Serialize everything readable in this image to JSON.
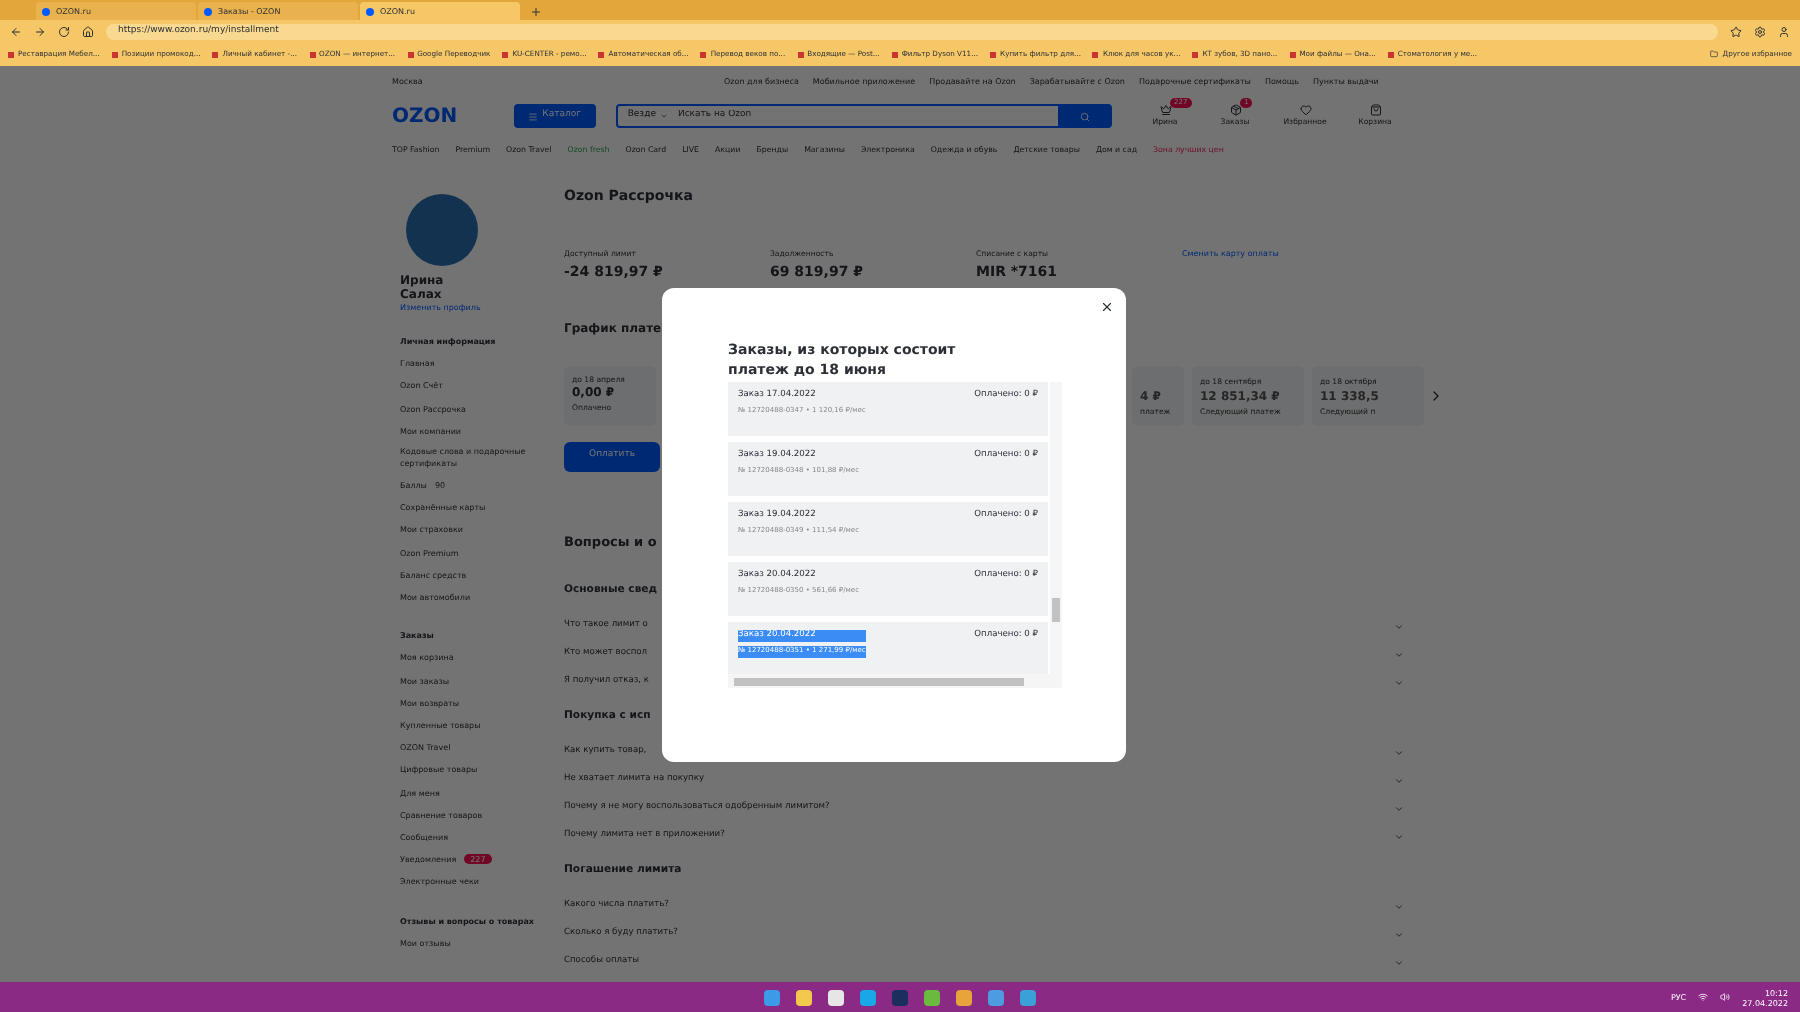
{
  "browser": {
    "tabs": [
      {
        "title": "OZON.ru",
        "selected": false
      },
      {
        "title": "Заказы - OZON",
        "selected": false
      },
      {
        "title": "OZON.ru",
        "selected": true
      }
    ],
    "address": "https://www.ozon.ru/my/installment",
    "bookmarks": [
      "Реставрация Мебел...",
      "Позиции промокод...",
      "Личный кабинет -...",
      "OZON — интернет...",
      "Google Переводчик",
      "KU-CENTER - ремо...",
      "Автоматическая об...",
      "Перевод веков по...",
      "Входящие — Post...",
      "Фильтр Dyson V11...",
      "Купить фильтр для...",
      "Клюк для часов ук...",
      "КТ зубов, 3D пано...",
      "Мои файлы — Она...",
      "Стоматология у ме..."
    ],
    "other_bookmarks": "Другое избранное"
  },
  "site": {
    "city": "Москва",
    "top_links": [
      "Ozon для бизнеса",
      "Мобильное приложение",
      "Продавайте на Ozon",
      "Зарабатывайте с Ozon",
      "Подарочные сертификаты",
      "Помощь",
      "Пункты выдачи"
    ],
    "logo": "OZON",
    "catalog": "Каталог",
    "search": {
      "scope": "Везде",
      "placeholder": "Искать на Ozon"
    },
    "header_icons": [
      {
        "label": "Ирина",
        "badge": "227"
      },
      {
        "label": "Заказы",
        "badge": "1"
      },
      {
        "label": "Избранное"
      },
      {
        "label": "Корзина"
      }
    ],
    "nav": [
      {
        "label": "TOP Fashion",
        "kind": "regular"
      },
      {
        "label": "Premium",
        "kind": "regular"
      },
      {
        "label": "Ozon Travel",
        "kind": "regular"
      },
      {
        "label": "Ozon fresh",
        "kind": "fresh"
      },
      {
        "label": "Ozon Card",
        "kind": "regular"
      },
      {
        "label": "LIVE",
        "kind": "regular"
      },
      {
        "label": "Акции",
        "kind": "regular"
      },
      {
        "label": "Бренды",
        "kind": "regular"
      },
      {
        "label": "Магазины",
        "kind": "regular"
      },
      {
        "label": "Электроника",
        "kind": "regular"
      },
      {
        "label": "Одежда и обувь",
        "kind": "regular"
      },
      {
        "label": "Детские товары",
        "kind": "regular"
      },
      {
        "label": "Дом и сад",
        "kind": "regular"
      },
      {
        "label": "Зона лучших цен",
        "kind": "promo"
      }
    ]
  },
  "sidebar": {
    "name": "Ирина Салах",
    "edit": "Изменить профиль",
    "sections": [
      {
        "title": "Личная информация",
        "items": [
          {
            "label": "Главная"
          },
          {
            "label": "Ozon Счёт"
          },
          {
            "label": "Ozon Рассрочка"
          },
          {
            "label": "Мои компании"
          },
          {
            "label": "Кодовые слова и подарочные сертификаты"
          },
          {
            "label": "Баллы",
            "count": "90"
          },
          {
            "label": "Сохранённые карты"
          },
          {
            "label": "Мои страховки"
          },
          {
            "label": "Ozon Premium"
          },
          {
            "label": "Баланс средств"
          },
          {
            "label": "Мои автомобили"
          }
        ]
      },
      {
        "title": "Заказы",
        "items": [
          {
            "label": "Моя корзина"
          },
          {
            "label": "Мои заказы"
          },
          {
            "label": "Мои возвраты"
          },
          {
            "label": "Купленные товары"
          },
          {
            "label": "OZON Travel"
          },
          {
            "label": "Цифровые товары"
          },
          {
            "label": "Для меня"
          },
          {
            "label": "Сравнение товаров"
          },
          {
            "label": "Сообщения"
          },
          {
            "label": "Уведомления",
            "badge": "227"
          },
          {
            "label": "Электронные чеки"
          }
        ]
      },
      {
        "title": "Отзывы и вопросы о товарах",
        "items": [
          {
            "label": "Мои отзывы"
          }
        ]
      }
    ]
  },
  "main": {
    "title": "Ozon Рассрочка",
    "stats": [
      {
        "label": "Доступный лимит",
        "value": "-24 819,97 ₽"
      },
      {
        "label": "Задолженность",
        "value": "69 819,97 ₽"
      },
      {
        "label": "Списание с карты",
        "value": "MIR *7161"
      }
    ],
    "change_card": "Сменить карту оплаты",
    "schedule_title": "График плате",
    "payments": [
      {
        "date": "до 18 апреля",
        "amount": "0,00 ₽",
        "status": "Оплачено"
      }
    ],
    "payments_right": [
      {
        "amount": "4 ₽",
        "status": "платеж"
      },
      {
        "date": "до 18 сентября",
        "amount": "12 851,34 ₽",
        "status": "Следующий платеж"
      },
      {
        "date": "до 18 октября",
        "amount": "11 338,5",
        "status": "Следующий п"
      }
    ],
    "pay_button": "Оплатить",
    "faq_title": "Вопросы и о",
    "faq": [
      {
        "title": "Основные свед",
        "questions": [
          "Что такое лимит о",
          "Кто может воспол",
          "Я получил отказ, к"
        ]
      },
      {
        "title": "Покупка с исп",
        "questions": [
          "Как купить товар,",
          "Не хватает лимита на покупку",
          "Почему я не могу воспользоваться одобренным лимитом?",
          "Почему лимита нет в приложении?"
        ]
      },
      {
        "title": "Погашение лимита",
        "questions": [
          "Какого числа платить?",
          "Сколько я буду платить?",
          "Способы оплаты"
        ]
      }
    ]
  },
  "modal": {
    "title": "Заказы, из которых состоит платеж до 18 июня",
    "orders": [
      {
        "title": "Заказ 17.04.2022",
        "detail": "№ 12720488-0347 • 1 120,16 ₽/мес",
        "paid": "Оплачено: 0 ₽",
        "highlighted": false
      },
      {
        "title": "Заказ 19.04.2022",
        "detail": "№ 12720488-0348 • 101,88 ₽/мес",
        "paid": "Оплачено: 0 ₽",
        "highlighted": false
      },
      {
        "title": "Заказ 19.04.2022",
        "detail": "№ 12720488-0349 • 111,54 ₽/мес",
        "paid": "Оплачено: 0 ₽",
        "highlighted": false
      },
      {
        "title": "Заказ 20.04.2022",
        "detail": "№ 12720488-0350 • 561,66 ₽/мес",
        "paid": "Оплачено: 0 ₽",
        "highlighted": false
      },
      {
        "title": "Заказ 20.04.2022",
        "detail": "№ 12720488-0351 • 1 271,99 ₽/мес",
        "paid": "Оплачено: 0 ₽",
        "highlighted": true
      }
    ]
  },
  "taskbar": {
    "language": "РУС",
    "time": "10:12",
    "date": "27.04.2022"
  }
}
